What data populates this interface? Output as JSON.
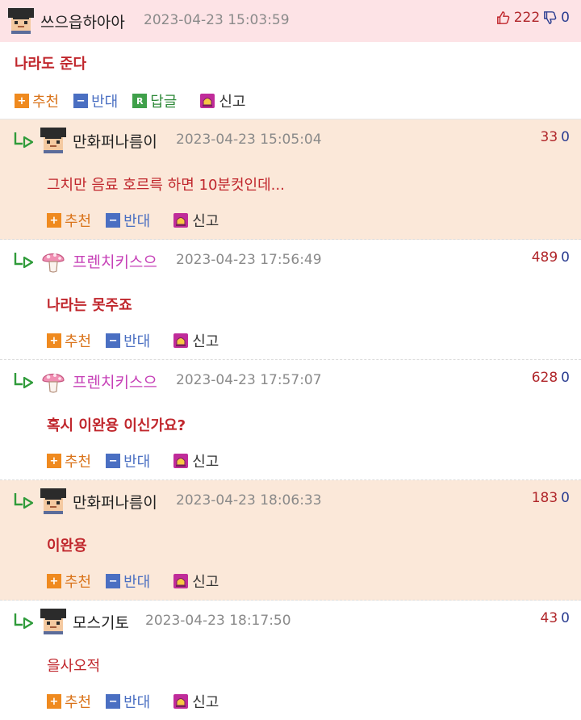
{
  "comments": [
    {
      "kind": "main",
      "nick": "쓰으읍하아아",
      "date": "2023-04-23 15:03:59",
      "up": "222",
      "down": "0",
      "text": "나라도 준다",
      "actions": {
        "recommend": "추천",
        "oppose": "반대",
        "reply": "답글",
        "report": "신고"
      }
    },
    {
      "kind": "reply",
      "nick": "만화퍼나름이",
      "date": "2023-04-23 15:05:04",
      "up": "33",
      "down": "0",
      "text": "그치만 음료 호르륵 하면 10분컷인데...",
      "actions": {
        "recommend": "추천",
        "oppose": "반대",
        "report": "신고"
      }
    },
    {
      "kind": "reply",
      "nick": "프렌치키스으",
      "date": "2023-04-23 17:56:49",
      "up": "489",
      "down": "0",
      "text": "나라는 못주죠",
      "actions": {
        "recommend": "추천",
        "oppose": "반대",
        "report": "신고"
      }
    },
    {
      "kind": "reply",
      "nick": "프렌치키스으",
      "date": "2023-04-23 17:57:07",
      "up": "628",
      "down": "0",
      "text": "혹시 이완용 이신가요?",
      "actions": {
        "recommend": "추천",
        "oppose": "반대",
        "report": "신고"
      }
    },
    {
      "kind": "reply",
      "nick": "만화퍼나름이",
      "date": "2023-04-23 18:06:33",
      "up": "183",
      "down": "0",
      "text": "이완용",
      "actions": {
        "recommend": "추천",
        "oppose": "반대",
        "report": "신고"
      }
    },
    {
      "kind": "reply",
      "nick": "모스기토",
      "date": "2023-04-23 18:17:50",
      "up": "43",
      "down": "0",
      "text": "을사오적",
      "actions": {
        "recommend": "추천",
        "oppose": "반대",
        "report": "신고"
      }
    }
  ],
  "icons": {
    "main_avatar": "pixel-face-icon",
    "reply_arrow": "reply-arrow-icon",
    "mushroom": "mushroom-icon",
    "thumbs_up": "thumbs-up-icon",
    "thumbs_down": "thumbs-down-icon",
    "siren": "siren-icon"
  },
  "colors": {
    "main_header_bg": "#fde3e6",
    "reply_highlight_bg": "#fbe8d9",
    "text_red": "#c0262c",
    "recommend_orange": "#ef8a1f",
    "oppose_blue": "#4a6fc2",
    "reply_green": "#3fa04a",
    "nick_pink": "#c640b7"
  }
}
